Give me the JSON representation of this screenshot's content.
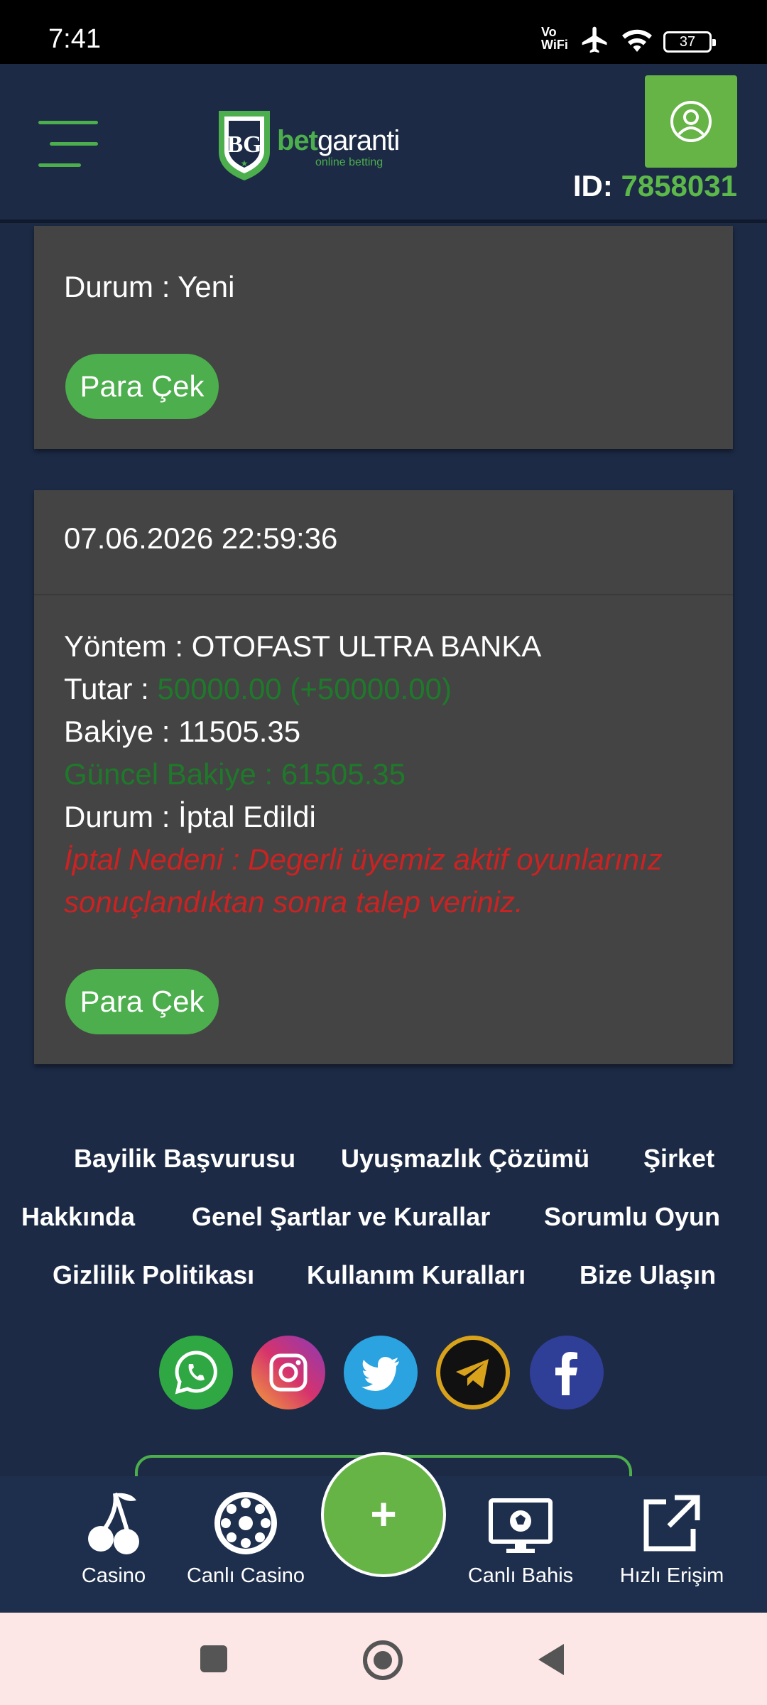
{
  "status_bar": {
    "time": "7:41",
    "vowifi_top": "Vo",
    "vowifi_bottom": "WiFi",
    "battery": "37"
  },
  "header": {
    "logo_bet": "bet",
    "logo_garanti": "garanti",
    "logo_sub": "online betting",
    "id_label": "ID:",
    "id_value": "7858031"
  },
  "card1": {
    "status": "Durum : Yeni",
    "button": "Para Çek"
  },
  "card2": {
    "date": "07.06.2026 22:59:36",
    "method": "Yöntem : OTOFAST ULTRA BANKA",
    "amount_label": "Tutar : ",
    "amount_value": "50000.00 (+50000.00)",
    "balance": "Bakiye : 11505.35",
    "current_balance": "Güncel Bakiye : 61505.35",
    "status": "Durum : İptal Edildi",
    "cancel_reason_1": "İptal Nedeni : Degerli üyemiz aktif oyunlarınız",
    "cancel_reason_2": "sonuçlandıktan sonra talep veriniz.",
    "button": "Para Çek"
  },
  "footer_links": [
    "Bayilik Başvurusu",
    "Uyuşmazlık Çözümü",
    "Şirket",
    "Hakkında",
    "Genel Şartlar ve Kurallar",
    "Sorumlu Oyun",
    "Gizlilik Politikası",
    "Kullanım Kuralları",
    "Bize Ulaşın"
  ],
  "social_icons": [
    "whatsapp-icon",
    "instagram-icon",
    "twitter-icon",
    "telegram-icon",
    "facebook-icon"
  ],
  "bottom_nav": {
    "casino": "Casino",
    "live_casino": "Canlı Casino",
    "fab": "+",
    "live_bet": "Canlı Bahis",
    "quick_access": "Hızlı Erişim"
  },
  "colors": {
    "accent": "#4cae4c",
    "background": "#1c2a45",
    "card": "#444444",
    "error": "#cc2222"
  }
}
